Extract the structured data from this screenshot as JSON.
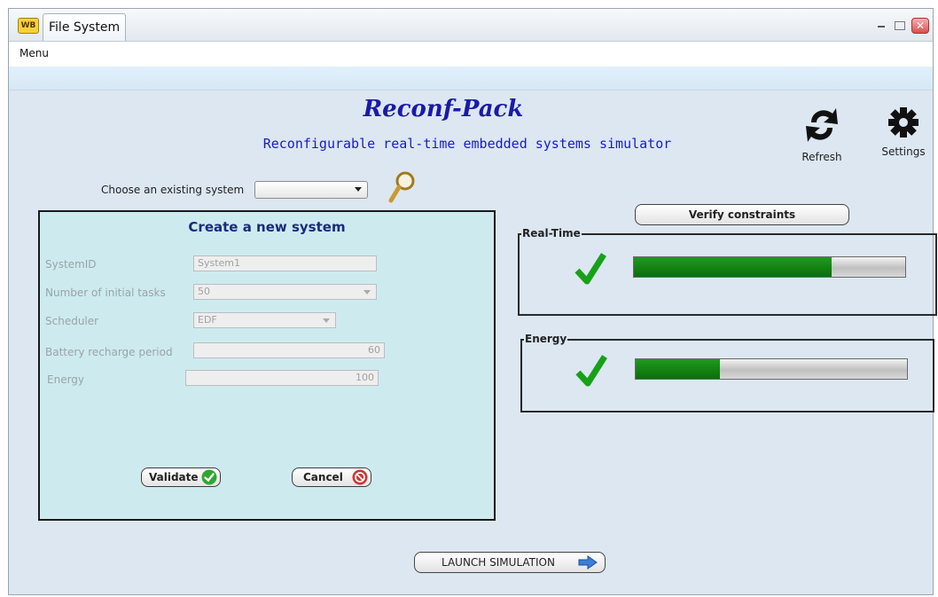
{
  "window": {
    "badge": "WB",
    "tab_title": "File System",
    "close_glyph": "✕"
  },
  "menu": {
    "label": "Menu"
  },
  "header": {
    "title": "Reconf-Pack",
    "subtitle": "Reconfigurable real-time embedded systems simulator",
    "refresh_label": "Refresh",
    "settings_label": "Settings"
  },
  "choose": {
    "label": "Choose an existing system",
    "selected": ""
  },
  "create": {
    "title": "Create a new system",
    "system_id_label": "SystemID",
    "system_id_value": "System1",
    "tasks_label": "Number of initial tasks",
    "tasks_value": "50",
    "scheduler_label": "Scheduler",
    "scheduler_value": "EDF",
    "battery_label": "Battery recharge period",
    "battery_value": "60",
    "energy_label": "Energy",
    "energy_value": "100",
    "validate_label": "Validate",
    "cancel_label": "Cancel"
  },
  "verify": {
    "label": "Verify constraints"
  },
  "realtime": {
    "legend": "Real-Time",
    "progress": 0.73,
    "status": "ok"
  },
  "energy": {
    "legend": "Energy",
    "progress": 0.31,
    "status": "ok"
  },
  "launch": {
    "label": "LAUNCH SIMULATION"
  },
  "colors": {
    "title_blue": "#1a1aa8",
    "panel_bg": "#cdebef",
    "check_green": "#1aa31a",
    "progress_green": "#0b7a0b"
  }
}
